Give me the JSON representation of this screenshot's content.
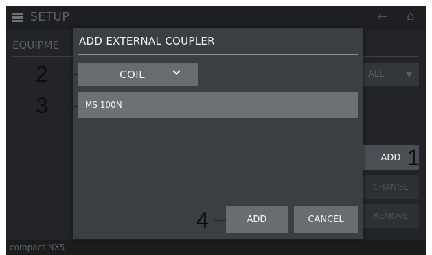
{
  "header": {
    "title": "SETUP",
    "icons": [
      "setup-menu-icon",
      "back-arrow-icon",
      "home-icon"
    ]
  },
  "background": {
    "section_title": "EQUIPME",
    "filter_value": "ALL",
    "add_label": "ADD",
    "change_label": "CHANGE",
    "remove_label": "REMOVE"
  },
  "footer": {
    "device_name": "compact NX5"
  },
  "dialog": {
    "title": "ADD EXTERNAL COUPLER",
    "type_select": {
      "selected": "COIL"
    },
    "list": {
      "items": [
        "MS 100N"
      ]
    },
    "add_label": "ADD",
    "cancel_label": "CANCEL"
  },
  "callouts": {
    "c1": "1",
    "c2": "2",
    "c3": "3",
    "c4": "4"
  }
}
